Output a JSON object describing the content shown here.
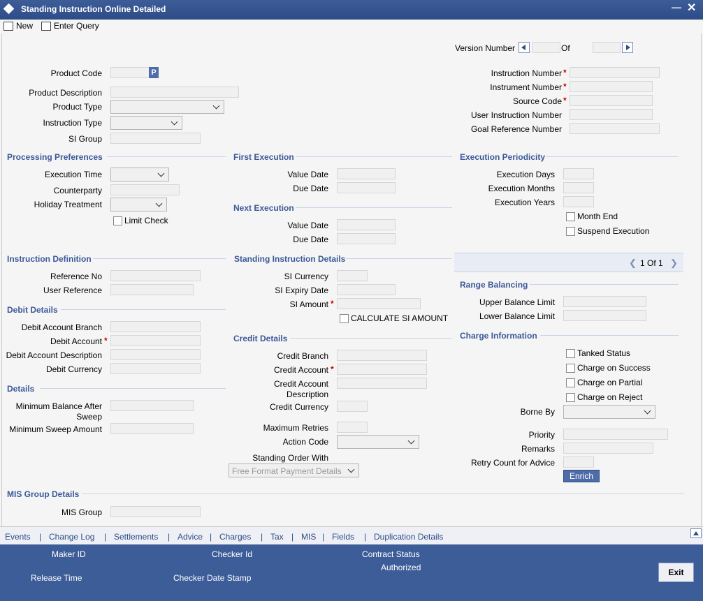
{
  "window": {
    "title": "Standing Instruction Online Detailed"
  },
  "toolbar": {
    "new_label": "New",
    "enter_query_label": "Enter Query"
  },
  "version": {
    "label": "Version Number",
    "of_label": "Of"
  },
  "header": {
    "product_code": "Product Code",
    "product_code_lov": "P",
    "product_description": "Product Description",
    "product_type": "Product Type",
    "instruction_type": "Instruction Type",
    "si_group": "SI Group",
    "instruction_number": "Instruction Number",
    "instrument_number": "Instrument Number",
    "source_code": "Source Code",
    "user_instruction_number": "User Instruction Number",
    "goal_reference_number": "Goal Reference Number",
    "required_mark": "*"
  },
  "processing": {
    "title": "Processing Preferences",
    "execution_time": "Execution Time",
    "counterparty": "Counterparty",
    "holiday_treatment": "Holiday Treatment",
    "limit_check": "Limit Check"
  },
  "first_execution": {
    "title": "First Execution",
    "value_date": "Value Date",
    "due_date": "Due Date"
  },
  "next_execution": {
    "title": "Next Execution",
    "value_date": "Value Date",
    "due_date": "Due Date"
  },
  "periodicity": {
    "title": "Execution Periodicity",
    "days": "Execution Days",
    "months": "Execution Months",
    "years": "Execution Years",
    "month_end": "Month End",
    "suspend": "Suspend Execution"
  },
  "pager": {
    "text": "1 Of 1"
  },
  "instruction_definition": {
    "title": "Instruction Definition",
    "reference_no": "Reference No",
    "user_reference": "User Reference"
  },
  "si_details": {
    "title": "Standing Instruction Details",
    "currency": "SI Currency",
    "expiry_date": "SI Expiry Date",
    "amount": "SI Amount",
    "calculate": "CALCULATE SI AMOUNT"
  },
  "range_balancing": {
    "title": "Range Balancing",
    "upper": "Upper Balance Limit",
    "lower": "Lower Balance Limit"
  },
  "debit_details": {
    "title": "Debit Details",
    "branch": "Debit Account Branch",
    "account": "Debit Account",
    "description": "Debit Account Description",
    "currency": "Debit Currency"
  },
  "credit_details": {
    "title": "Credit Details",
    "branch": "Credit Branch",
    "account": "Credit Account",
    "description_line1": "Credit Account",
    "description_line2": "Description",
    "currency": "Credit Currency",
    "max_retries": "Maximum Retries",
    "action_code": "Action Code",
    "standing_order_with": "Standing Order With",
    "standing_order_value": "Free Format Payment Details"
  },
  "charge_information": {
    "title": "Charge Information",
    "tanked_status": "Tanked Status",
    "on_success": "Charge on Success",
    "on_partial": "Charge on Partial",
    "on_reject": "Charge on Reject",
    "borne_by": "Borne By",
    "priority": "Priority",
    "remarks": "Remarks",
    "retry_count": "Retry Count for Advice",
    "enrich": "Enrich"
  },
  "details": {
    "title": "Details",
    "min_balance_line1": "Minimum Balance After",
    "min_balance_line2": "Sweep",
    "min_sweep": "Minimum Sweep Amount"
  },
  "mis": {
    "title": "MIS Group Details",
    "group": "MIS Group"
  },
  "tabs": [
    "Events",
    "Change Log",
    "Settlements",
    "Advice",
    "Charges",
    "Tax",
    "MIS",
    "Fields",
    "Duplication Details"
  ],
  "tab_separator": "|",
  "footer": {
    "maker_id": "Maker ID",
    "checker_id": "Checker Id",
    "contract_status": "Contract Status",
    "authorized": "Authorized",
    "release_time": "Release Time",
    "checker_date_stamp": "Checker Date Stamp",
    "exit": "Exit"
  },
  "colors": {
    "titlebar": "#3d5d99",
    "section": "#3b5998",
    "required": "#cc0000"
  }
}
